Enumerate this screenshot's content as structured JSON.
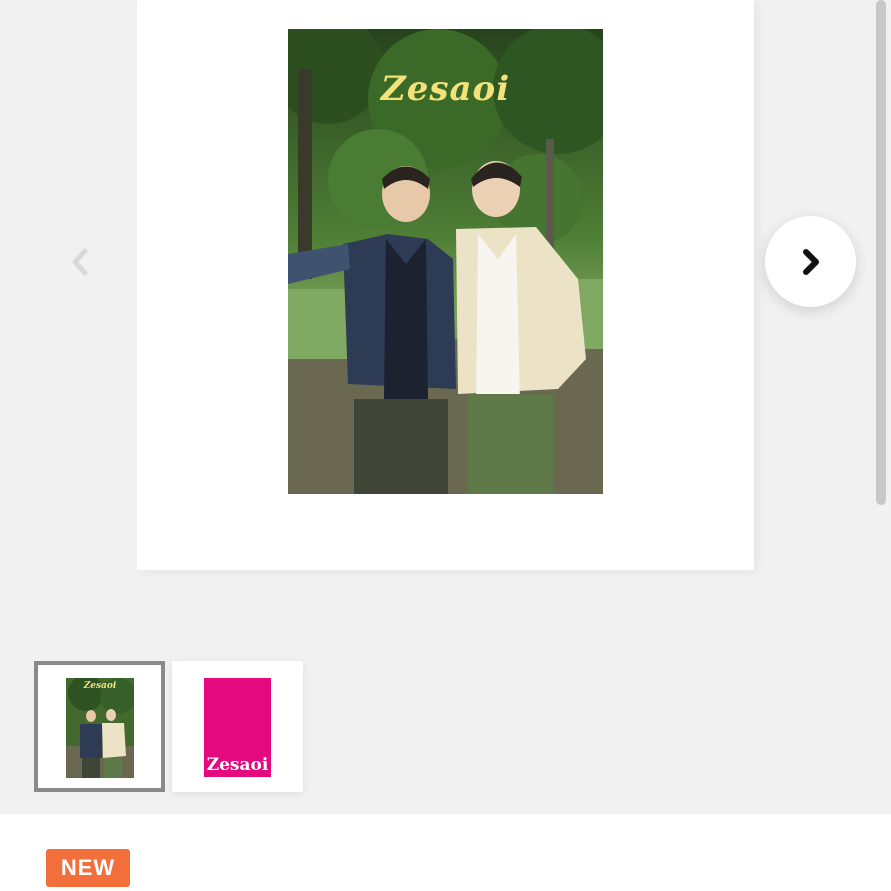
{
  "gallery": {
    "main_image": {
      "logo_text": "Zesaoi",
      "alt": "Zesaoi"
    },
    "prev_icon": "chevron-left-icon",
    "next_icon": "chevron-right-icon",
    "thumbnails": [
      {
        "logo_text": "Zesaoi",
        "selected": true
      },
      {
        "logo_text": "Zesaoi",
        "selected": false,
        "small_text": "",
        "cover_color": "#e4097f"
      }
    ]
  },
  "product": {
    "badge": "NEW"
  },
  "colors": {
    "background": "#f1f1f1",
    "badge": "#f26f3b",
    "pink_cover": "#e4097f",
    "logo_yellow": "#f3e27a"
  }
}
